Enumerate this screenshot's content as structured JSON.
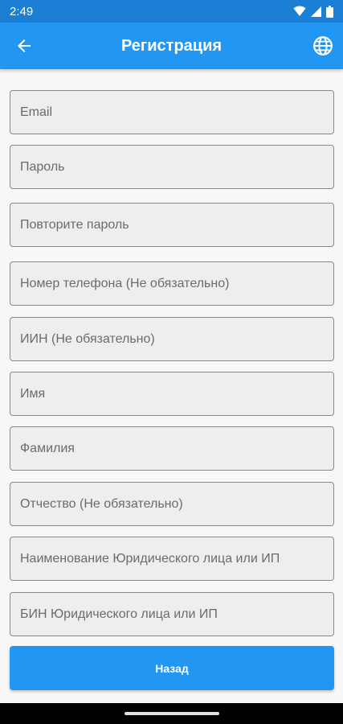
{
  "status_bar": {
    "time": "2:49"
  },
  "app_bar": {
    "title": "Регистрация"
  },
  "fields": [
    {
      "name": "email-field",
      "placeholder": "Email",
      "value": ""
    },
    {
      "name": "password-field",
      "placeholder": "Пароль",
      "value": ""
    },
    {
      "name": "repeat-password-field",
      "placeholder": "Повторите пароль",
      "value": ""
    },
    {
      "name": "phone-field",
      "placeholder": "Номер телефона (Не обязательно)",
      "value": ""
    },
    {
      "name": "iin-field",
      "placeholder": "ИИН (Не обязательно)",
      "value": ""
    },
    {
      "name": "first-name-field",
      "placeholder": "Имя",
      "value": ""
    },
    {
      "name": "last-name-field",
      "placeholder": "Фамилия",
      "value": ""
    },
    {
      "name": "patronymic-field",
      "placeholder": "Отчество (Не обязательно)",
      "value": ""
    },
    {
      "name": "company-name-field",
      "placeholder": "Наименование Юридического лица или ИП",
      "value": ""
    },
    {
      "name": "bin-field",
      "placeholder": "БИН Юридического лица или ИП",
      "value": ""
    }
  ],
  "actions": {
    "back_label": "Назад"
  },
  "colors": {
    "primary": "#2196f3",
    "status_bar": "#1c7fd6",
    "field_bg": "#eeeeee"
  },
  "icons": {
    "back": "arrow-left-icon",
    "language": "globe-icon"
  }
}
